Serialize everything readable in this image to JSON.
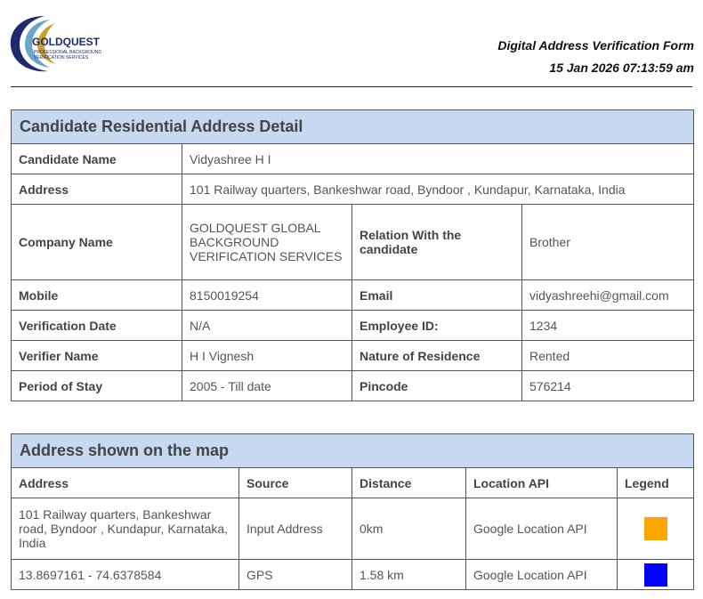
{
  "header": {
    "logo_text": "GOLDQUEST",
    "logo_tagline_1": "PROFESSIONAL BACKGROUND",
    "logo_tagline_2": "VERIFICATION SERVICES",
    "form_title": "Digital Address Verification Form",
    "timestamp": "15 Jan 2026 07:13:59 am"
  },
  "candidate": {
    "section_title": "Candidate Residential Address Detail",
    "name_label": "Candidate Name",
    "name_value": "Vidyashree H I",
    "address_label": "Address",
    "address_value": "101 Railway quarters, Bankeshwar road, Byndoor , Kundapur, Karnataka, India",
    "company_label": "Company Name",
    "company_value": "GOLDQUEST GLOBAL BACKGROUND VERIFICATION SERVICES",
    "relation_label": "Relation With the candidate",
    "relation_value": "Brother",
    "mobile_label": "Mobile",
    "mobile_value": "8150019254",
    "email_label": "Email",
    "email_value": "vidyashreehi@gmail.com",
    "verification_date_label": "Verification Date",
    "verification_date_value": "N/A",
    "employee_id_label": "Employee ID:",
    "employee_id_value": "1234",
    "verifier_label": "Verifier Name",
    "verifier_value": "H I Vignesh",
    "residence_label": "Nature of Residence",
    "residence_value": "Rented",
    "period_label": "Period of Stay",
    "period_value": "2005 - Till date",
    "pincode_label": "Pincode",
    "pincode_value": "576214"
  },
  "map_section": {
    "section_title": "Address shown on the map",
    "columns": {
      "address": "Address",
      "source": "Source",
      "distance": "Distance",
      "location_api": "Location API",
      "legend": "Legend"
    },
    "rows": [
      {
        "address": "101 Railway quarters, Bankeshwar road, Byndoor , Kundapur, Karnataka, India",
        "source": "Input Address",
        "distance": "0km",
        "location_api": "Google Location API",
        "legend_color": "#ffa500"
      },
      {
        "address": "13.8697161 - 74.6378584",
        "source": "GPS",
        "distance": "1.58 km",
        "location_api": "Google Location API",
        "legend_color": "#0000ff"
      }
    ]
  },
  "colors": {
    "section_header_bg": "#c6d9f1",
    "logo_navy": "#1f2b6e",
    "logo_gold": "#c9a227"
  }
}
